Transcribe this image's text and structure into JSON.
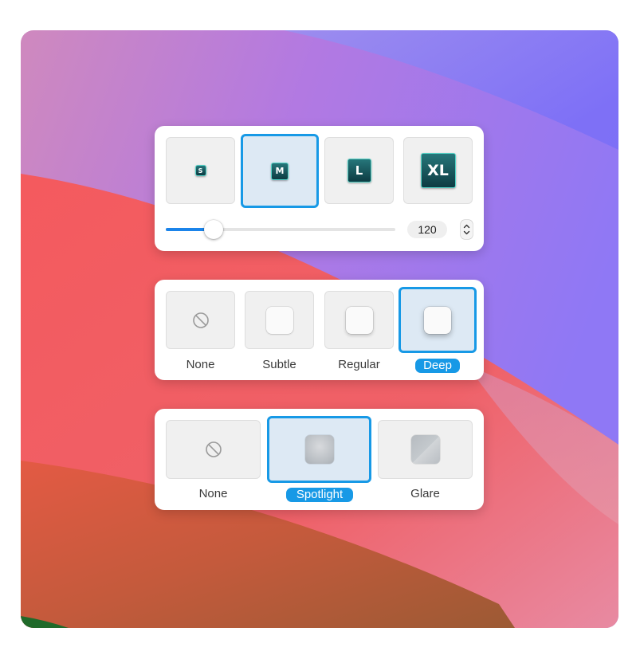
{
  "icon_size_panel": {
    "options": [
      {
        "label": "S",
        "selected": false
      },
      {
        "label": "M",
        "selected": true
      },
      {
        "label": "L",
        "selected": false
      },
      {
        "label": "XL",
        "selected": false
      }
    ],
    "slider": {
      "value": 120,
      "fill_fraction": 0.21
    },
    "value_text": "120",
    "stepper_icon": "up-down-chevron-icon"
  },
  "depth_panel": {
    "options": [
      {
        "label": "None",
        "icon": "prohibited-icon",
        "selected": false
      },
      {
        "label": "Subtle",
        "icon": "square-subtle-shadow",
        "selected": false
      },
      {
        "label": "Regular",
        "icon": "square-regular-shadow",
        "selected": false
      },
      {
        "label": "Deep",
        "icon": "square-deep-shadow",
        "selected": true
      }
    ]
  },
  "lighting_panel": {
    "options": [
      {
        "label": "None",
        "icon": "prohibited-icon",
        "selected": false
      },
      {
        "label": "Spotlight",
        "icon": "square-spotlight",
        "selected": true
      },
      {
        "label": "Glare",
        "icon": "square-glare",
        "selected": false
      }
    ]
  },
  "colors": {
    "accent": "#1799e6",
    "selected_tile_bg": "#dde9f4",
    "key_border": "#54d3c7",
    "key_fill": "#0d3b42"
  }
}
